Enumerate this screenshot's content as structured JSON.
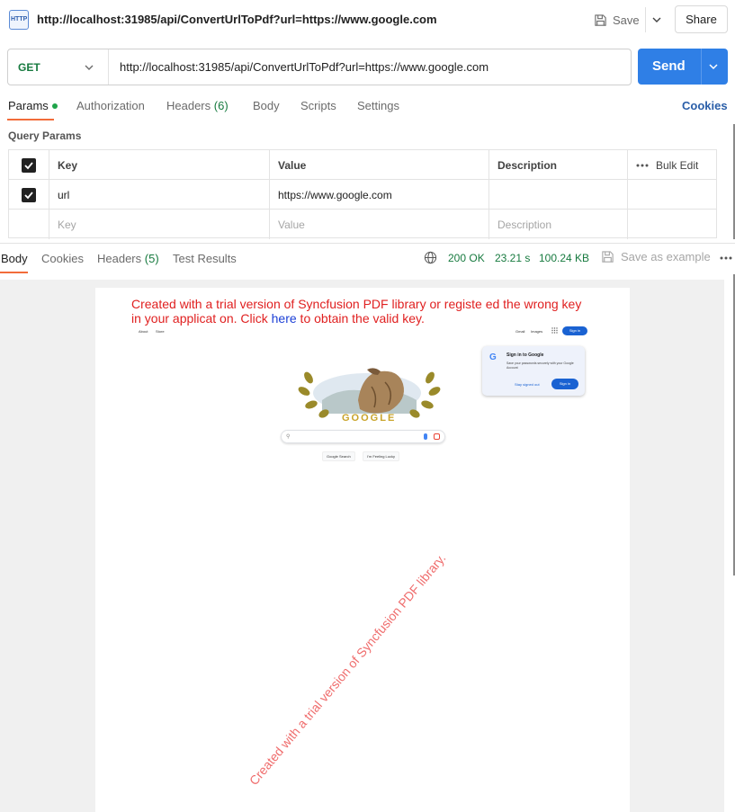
{
  "titlebar": {
    "icon_label": "HTTP",
    "tab_title": "http://localhost:31985/api/ConvertUrlToPdf?url=https://www.google.com",
    "save_label": "Save",
    "share_label": "Share"
  },
  "request": {
    "method": "GET",
    "url": "http://localhost:31985/api/ConvertUrlToPdf?url=https://www.google.com",
    "send_label": "Send"
  },
  "request_tabs": {
    "items": [
      {
        "label": "Params",
        "active": true
      },
      {
        "label": "Authorization"
      },
      {
        "label": "Headers",
        "count": "(6)"
      },
      {
        "label": "Body"
      },
      {
        "label": "Scripts"
      },
      {
        "label": "Settings"
      }
    ],
    "cookies_link": "Cookies"
  },
  "query_params": {
    "title": "Query Params",
    "headers": {
      "key": "Key",
      "value": "Value",
      "description": "Description",
      "bulk_edit": "Bulk Edit"
    },
    "rows": [
      {
        "checked": true,
        "key": "url",
        "value": "https://www.google.com",
        "description": ""
      }
    ],
    "placeholders": {
      "key": "Key",
      "value": "Value",
      "description": "Description"
    }
  },
  "response": {
    "tabs": [
      {
        "label": "Body",
        "active": true
      },
      {
        "label": "Cookies"
      },
      {
        "label": "Headers",
        "count": "(5)"
      },
      {
        "label": "Test Results"
      }
    ],
    "status": "200 OK",
    "time": "23.21 s",
    "size": "100.24 KB",
    "save_example": "Save as example"
  },
  "pdf_page": {
    "watermark_line1": "Created with a trial version of Syncfusion  PDF library or registe ed the wrong key",
    "watermark_line2_pre": "in your applicat on. Click ",
    "watermark_link": "here",
    "watermark_line2_post": " to obtain the valid key.",
    "watermark_diagonal": "Created with a trial version of Syncfusion PDF library.",
    "google": {
      "nav_about": "About",
      "nav_store": "Store",
      "nav_gmail": "Gmail",
      "nav_images": "Images",
      "signin_btn": "Sign in",
      "card_title": "Sign in to Google",
      "card_body": "Save your passwords securely with your Google Account",
      "card_stay": "Stay signed out",
      "card_signin": "Sign in",
      "logo_letter": "G",
      "doodle_text": "GOOGLE",
      "search_btn": "Google Search",
      "lucky_btn": "I'm Feeling Lucky"
    }
  }
}
